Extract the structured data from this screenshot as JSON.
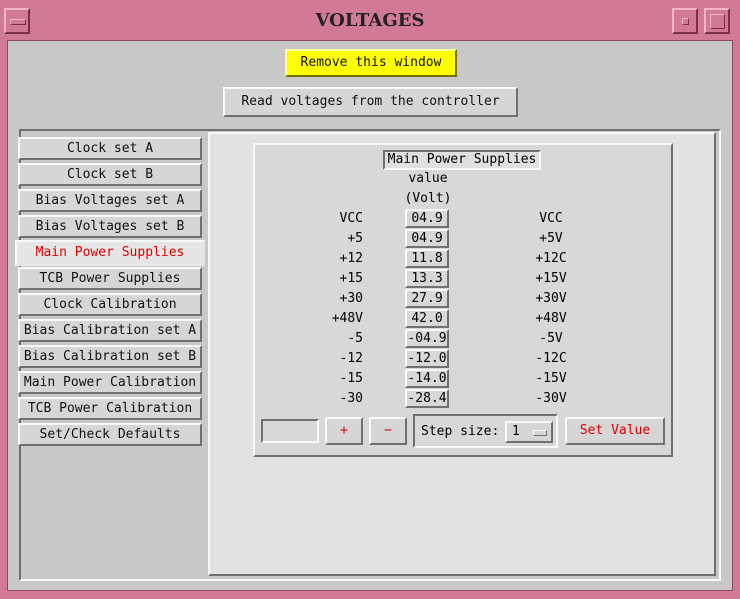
{
  "window": {
    "title": "VOLTAGES"
  },
  "toolbar": {
    "remove_label": "Remove this window",
    "read_label": "Read voltages from the controller"
  },
  "tabs": [
    {
      "label": "Clock set A"
    },
    {
      "label": "Clock set B"
    },
    {
      "label": "Bias Voltages set A"
    },
    {
      "label": "Bias Voltages set B"
    },
    {
      "label": "Main Power Supplies",
      "active": true
    },
    {
      "label": "TCB Power Supplies"
    },
    {
      "label": "Clock Calibration"
    },
    {
      "label": "Bias Calibration set A"
    },
    {
      "label": "Bias Calibration set B"
    },
    {
      "label": "Main Power Calibration"
    },
    {
      "label": "TCB Power Calibration"
    },
    {
      "label": "Set/Check Defaults"
    }
  ],
  "panel": {
    "title": "Main Power Supplies",
    "col_value": "value",
    "col_unit": "(Volt)",
    "rows": [
      {
        "left": "VCC",
        "value": "04.9",
        "right": "VCC"
      },
      {
        "left": "+5",
        "value": "04.9",
        "right": "+5V"
      },
      {
        "left": "+12",
        "value": "11.8",
        "right": "+12C"
      },
      {
        "left": "+15",
        "value": "13.3",
        "right": "+15V"
      },
      {
        "left": "+30",
        "value": "27.9",
        "right": "+30V"
      },
      {
        "left": "+48V",
        "value": "42.0",
        "right": "+48V"
      },
      {
        "left": "-5",
        "value": "-04.9",
        "right": "-5V"
      },
      {
        "left": "-12",
        "value": "-12.0",
        "right": "-12C"
      },
      {
        "left": "-15",
        "value": "-14.0",
        "right": "-15V"
      },
      {
        "left": "-30",
        "value": "-28.4",
        "right": "-30V"
      }
    ]
  },
  "controls": {
    "plus_label": "+",
    "minus_label": "−",
    "step_label": "Step size:",
    "step_value": "1",
    "set_label": "Set Value"
  },
  "colors": {
    "title_bar": "#d27a95",
    "remove_button": "#ffff00",
    "accent_text": "#e00000"
  }
}
